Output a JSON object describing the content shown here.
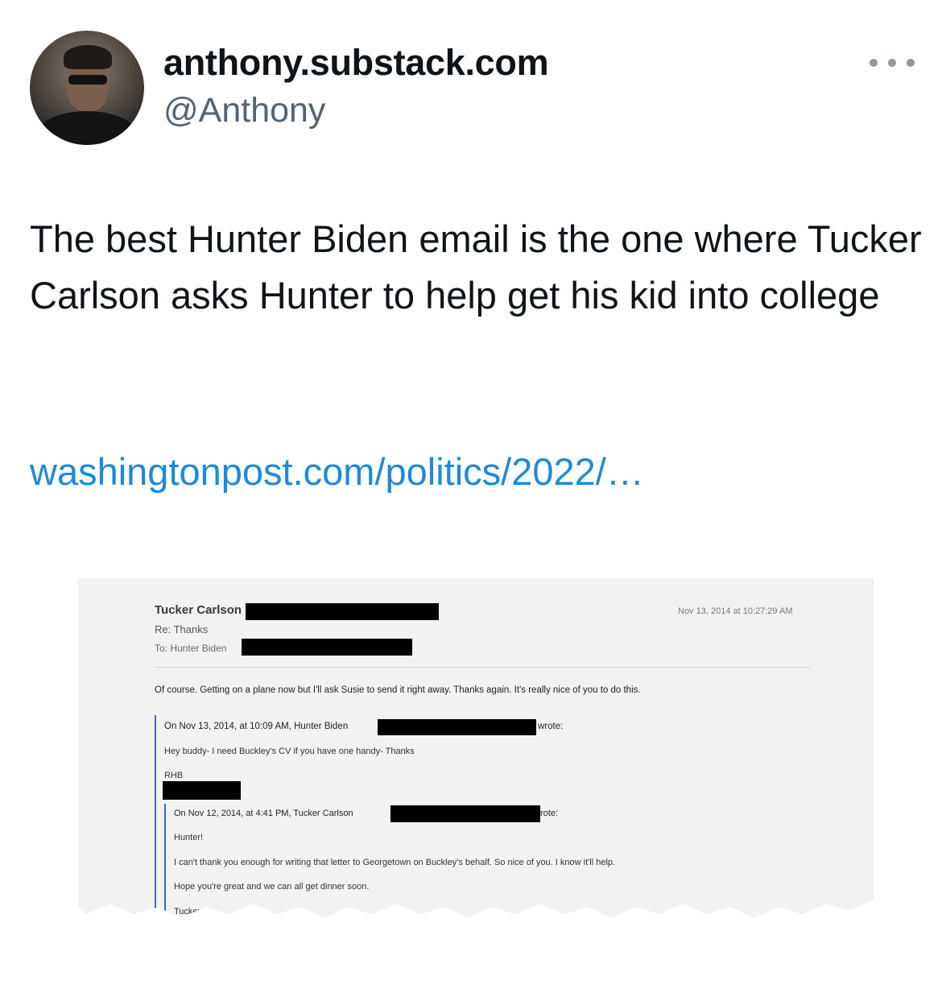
{
  "tweet": {
    "display_name": "anthony.substack.com",
    "handle": "@Anthony",
    "text": "The best Hunter Biden email is the one where Tucker Carlson asks Hunter to help get his kid into college",
    "link": "washingtonpost.com/politics/2022/…",
    "link_color": "#1d8ad8",
    "more_icon": "more-horizontal-icon"
  },
  "email": {
    "from": "Tucker Carlson",
    "subject": "Re: Thanks",
    "to": "To: Hunter Biden",
    "date": "Nov 13, 2014 at 10:27:29 AM",
    "body": "Of course. Getting on a plane now but I'll ask Susie to send it right away. Thanks again. It's really nice of you to do this.",
    "quote1": {
      "header": "On Nov 13, 2014, at 10:09 AM, Hunter Biden",
      "wrote": "wrote:",
      "body": "Hey buddy- I need Buckley's CV if you have one handy- Thanks",
      "signature": "RHB"
    },
    "quote2": {
      "header": "On Nov 12, 2014, at 4:41 PM, Tucker Carlson",
      "wrote": "rote:",
      "line1": "Hunter!",
      "line2": "I can't thank you enough for writing that letter to Georgetown on Buckley's behalf. So nice of you. I know it'll help.",
      "line3": "Hope you're great and we can all get dinner soon.",
      "line4": "Tucker"
    }
  }
}
